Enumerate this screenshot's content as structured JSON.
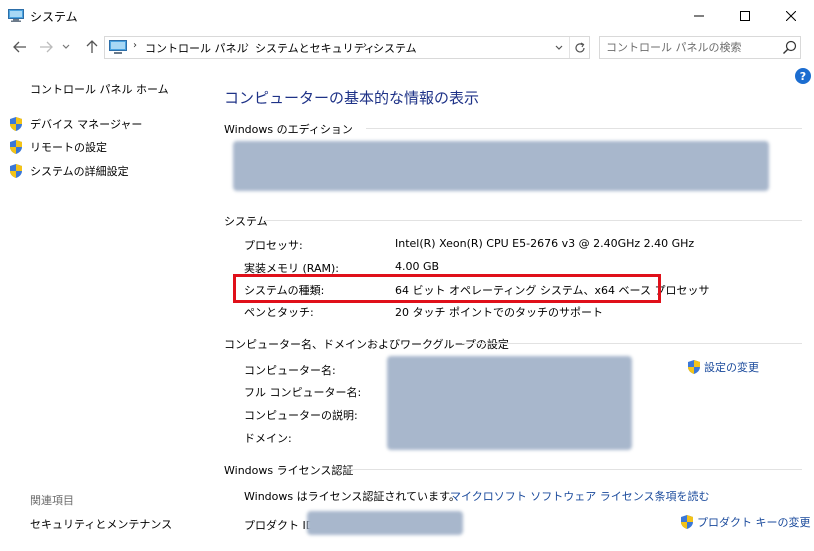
{
  "window": {
    "title": "システム",
    "minimize_icon": "minimize-icon",
    "maximize_icon": "maximize-icon",
    "close_icon": "close-icon"
  },
  "nav": {
    "back_icon": "arrow-left-icon",
    "forward_icon": "arrow-right-icon",
    "recent_icon": "chevron-down-icon",
    "up_icon": "arrow-up-icon"
  },
  "breadcrumb": {
    "items": [
      "コントロール パネル",
      "システムとセキュリティ",
      "システム"
    ],
    "separator": "›"
  },
  "search": {
    "placeholder": "コントロール パネルの検索"
  },
  "left_pane": {
    "home": "コントロール パネル ホーム",
    "tasks": [
      "デバイス マネージャー",
      "リモートの設定",
      "システムの詳細設定"
    ],
    "see_also_heading": "関連項目",
    "see_also_links": [
      "セキュリティとメンテナンス"
    ]
  },
  "help_label": "?",
  "main": {
    "title": "コンピューターの基本的な情報の表示",
    "edition_heading": "Windows のエディション",
    "system_heading": "システム",
    "system_rows": [
      {
        "label": "プロセッサ:",
        "value": "Intel(R) Xeon(R) CPU E5-2676 v3 @ 2.40GHz   2.40 GHz"
      },
      {
        "label": "実装メモリ (RAM):",
        "value": "4.00 GB"
      },
      {
        "label": "システムの種類:",
        "value": "64 ビット オペレーティング システム、x64 ベース プロセッサ"
      },
      {
        "label": "ペンとタッチ:",
        "value": "20 タッチ ポイントでのタッチのサポート"
      }
    ],
    "computer_heading": "コンピューター名、ドメインおよびワークグループの設定",
    "computer_rows": [
      "コンピューター名:",
      "フル コンピューター名:",
      "コンピューターの説明:",
      "ドメイン:"
    ],
    "change_settings": "設定の変更",
    "activation_heading": "Windows ライセンス認証",
    "activation_status": "Windows はライセンス認証されています。",
    "license_link": "マイクロソフト ソフトウェア ライセンス条項を読む",
    "product_id_label": "プロダクト ID:",
    "change_key": "プロダクト キーの変更"
  },
  "colors": {
    "title_blue": "#1e3287",
    "link_blue": "#1a4a9c",
    "highlight_red": "#e0101a",
    "redaction": "#a8b7cc"
  }
}
